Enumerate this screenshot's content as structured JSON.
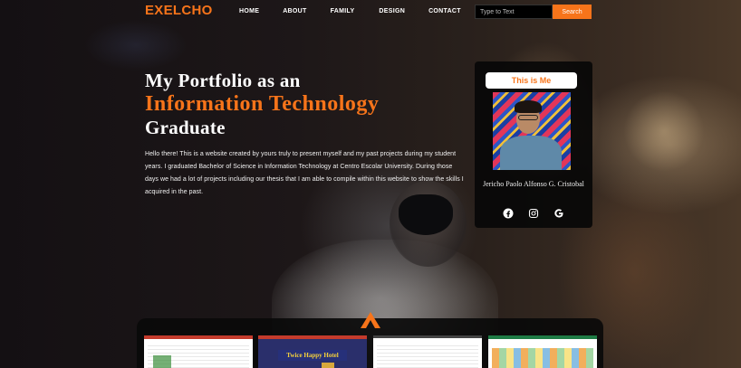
{
  "brand": {
    "logo": "EXELCHO"
  },
  "nav": {
    "items": [
      {
        "label": "HOME"
      },
      {
        "label": "ABOUT"
      },
      {
        "label": "FAMILY"
      },
      {
        "label": "DESIGN"
      },
      {
        "label": "CONTACT"
      }
    ]
  },
  "search": {
    "placeholder": "Type to Text",
    "button_label": "Search"
  },
  "hero": {
    "title_line1": "My Portfolio as an",
    "title_line2": "Information Technology",
    "title_line3": "Graduate",
    "intro": "Hello there! This is a website created by yours truly to present myself and my past projects during my student years. I graduated Bachelor of Science in Information Technology at Centro Escolar University. During those days we had a lot of projects including our thesis that I am able to compile within this website to show the skills I acquired in the past."
  },
  "profile": {
    "label": "This is Me",
    "name": "Jericho Paolo Alfonso G. Cristobal",
    "socials": [
      "facebook-icon",
      "instagram-icon",
      "google-icon"
    ]
  },
  "gallery": {
    "thumb2_banner": "Twice Happy Hotel"
  },
  "colors": {
    "accent": "#f7741a",
    "card_bg": "#080808"
  }
}
